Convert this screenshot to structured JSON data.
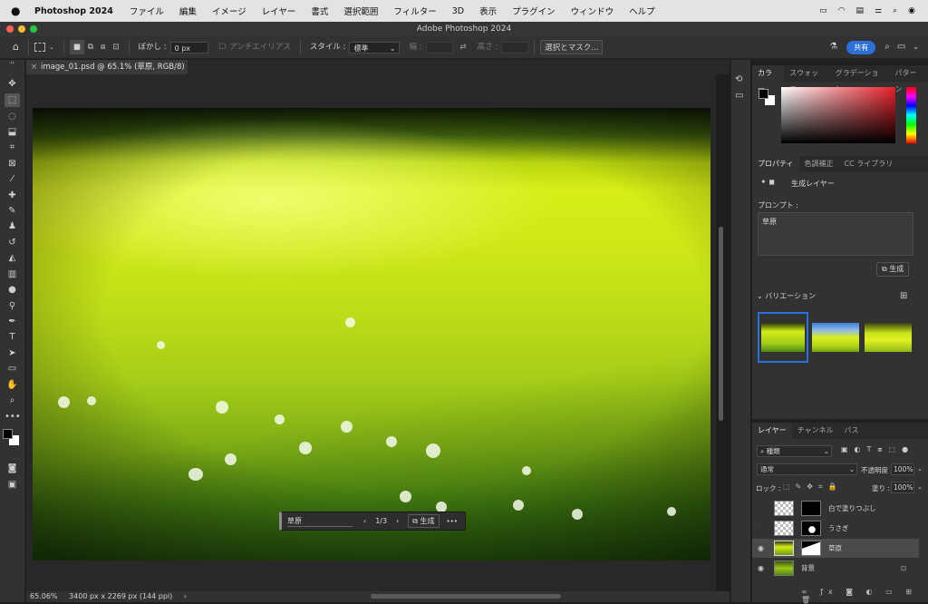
{
  "menubar": {
    "app": "Photoshop 2024",
    "items": [
      "ファイル",
      "編集",
      "イメージ",
      "レイヤー",
      "書式",
      "選択範囲",
      "フィルター",
      "3D",
      "表示",
      "プラグイン",
      "ウィンドウ",
      "ヘルプ"
    ]
  },
  "window": {
    "title": "Adobe Photoshop 2024"
  },
  "options": {
    "feather_label": "ぼかし :",
    "feather_value": "0 px",
    "antialias_label": "アンチエイリアス",
    "style_label": "スタイル :",
    "style_value": "標準",
    "width_label": "幅 :",
    "height_label": "高さ :",
    "select_mask_button": "選択とマスク...",
    "share_button": "共有"
  },
  "document": {
    "tab_title": "image_01.psd @ 65.1% (草原, RGB/8) *"
  },
  "context_bar": {
    "prompt": "草原",
    "page": "1/3",
    "generate_label": "生成",
    "more": "•••"
  },
  "status": {
    "zoom": "65.06%",
    "info": "3400 px x 2269 px (144 ppi)"
  },
  "color_panel": {
    "tabs": [
      "カラー",
      "スウォッチ",
      "グラデーション",
      "パターン"
    ]
  },
  "properties_panel": {
    "tabs": [
      "プロパティ",
      "色調補正",
      "CC ライブラリ"
    ],
    "layer_type": "生成レイヤー",
    "prompt_label": "プロンプト :",
    "prompt_value": "草原",
    "generate_button": "生成",
    "variations_label": "バリエーション"
  },
  "layers_panel": {
    "tabs": [
      "レイヤー",
      "チャンネル",
      "パス"
    ],
    "filter_kind": "種類",
    "blend_mode": "通常",
    "opacity_label": "不透明度 :",
    "opacity_value": "100%",
    "lock_label": "ロック :",
    "fill_label": "塗り :",
    "fill_value": "100%",
    "layers": [
      {
        "name": "白で塗りつぶし",
        "visible": false
      },
      {
        "name": "うさぎ",
        "visible": false
      },
      {
        "name": "草原",
        "visible": true,
        "selected": true
      },
      {
        "name": "背景",
        "visible": true,
        "locked": true
      }
    ]
  },
  "colors": {
    "accent": "#2c6fd8",
    "selected_row": "#4a4a4a"
  }
}
